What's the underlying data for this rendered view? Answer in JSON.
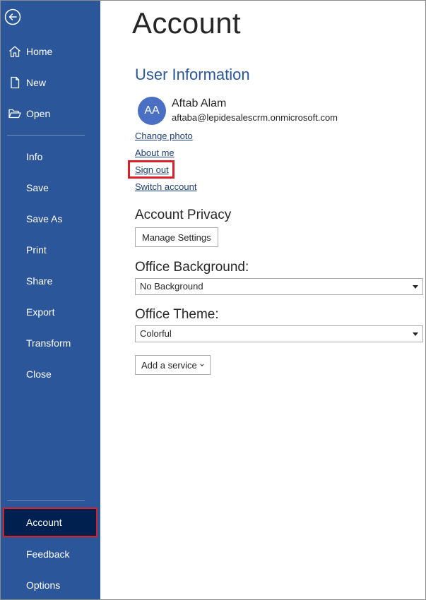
{
  "sidebar": {
    "back_icon": "back-arrow-icon",
    "top_items": [
      {
        "label": "Home",
        "icon": "home-icon"
      },
      {
        "label": "New",
        "icon": "new-document-icon"
      },
      {
        "label": "Open",
        "icon": "open-folder-icon"
      }
    ],
    "items": [
      {
        "label": "Info"
      },
      {
        "label": "Save"
      },
      {
        "label": "Save As"
      },
      {
        "label": "Print"
      },
      {
        "label": "Share"
      },
      {
        "label": "Export"
      },
      {
        "label": "Transform"
      },
      {
        "label": "Close"
      }
    ],
    "bottom_items": [
      {
        "label": "Account",
        "selected": true
      },
      {
        "label": "Feedback"
      },
      {
        "label": "Options"
      }
    ],
    "bg_color": "#2b579a",
    "selected_bg_color": "#00214f",
    "highlight_color": "#d7212a"
  },
  "main": {
    "title": "Account",
    "user_info": {
      "heading": "User Information",
      "avatar_initials": "AA",
      "name": "Aftab Alam",
      "email": "aftaba@lepidesalescrm.onmicrosoft.com",
      "links": {
        "change_photo": "Change photo",
        "about_me": "About me",
        "sign_out": "Sign out",
        "switch_account": "Switch account"
      }
    },
    "privacy": {
      "heading": "Account Privacy",
      "button": "Manage Settings"
    },
    "background": {
      "heading": "Office Background:",
      "selected": "No Background"
    },
    "theme": {
      "heading": "Office Theme:",
      "selected": "Colorful"
    },
    "add_service": {
      "label": "Add a service"
    }
  }
}
